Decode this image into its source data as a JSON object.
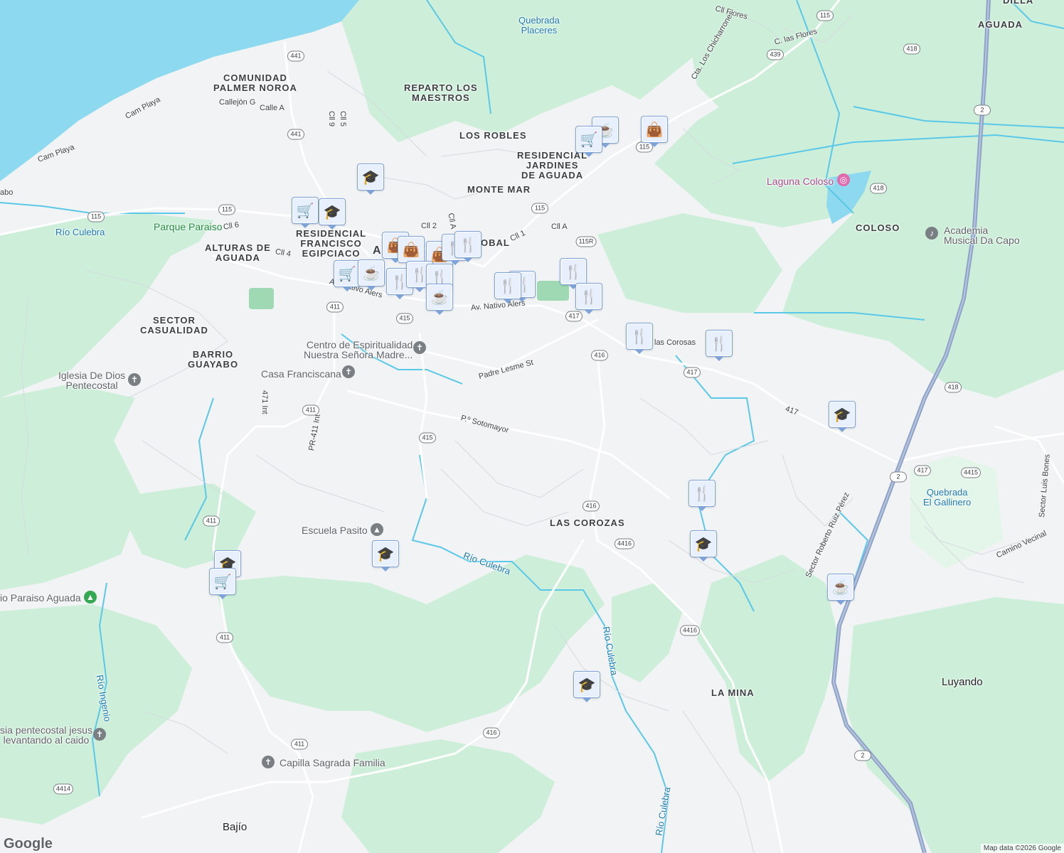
{
  "map": {
    "attribution": "Map data ©2026 Google",
    "logo": "Google",
    "colors": {
      "background": "#f1f3f4",
      "water": "#8dd9ef",
      "park": "#cdefd9",
      "road": "#ffffff",
      "highway": "#8fa3c8",
      "river": "#5ac8e8",
      "marker_fill": "#e8f0fe",
      "marker_icon": "#0b3c6f"
    }
  },
  "labels": {
    "comunidad_palmer": "COMUNIDAD\nPALMER NOROA",
    "reparto_maestros": "REPARTO LOS\nMAESTROS",
    "los_robles": "LOS ROBLES",
    "residencial_jardines": "RESIDENCIAL\nJARDINES\nDE AGUADA",
    "monte_mar": "MONTE MAR",
    "residencial_francisco": "RESIDENCIAL\nFRANCISCO\nEGIPCIACO",
    "alturas_aguada": "ALTURAS DE\nAGUADA",
    "sector_casualidad": "SECTOR\nCASUALIDAD",
    "barrio_guayabo": "BARRIO\nGUAYABO",
    "coloso": "COLOSO",
    "las_corozas": "LAS COROZAS",
    "la_mina": "LA MINA",
    "aguada_top": "AGUADA",
    "dilla": "DILLA",
    "obal": "OBAL",
    "ag": "AG",
    "luyando": "Luyando",
    "bajio": "Bajío"
  },
  "streets": {
    "cll_flores": "Cll Flores",
    "c_las_flores": "C. las Flores",
    "cta_chicharrones": "Cta. Los Chicharrones",
    "callejon_g": "Callejón G",
    "calle_a": "Calle A",
    "cam_playa_1": "Cam Playa",
    "cam_playa_2": "Cam Playa",
    "cll_6": "Cll 6",
    "cll_4": "Cll 4",
    "cll_9": "Cll 9",
    "cll_5": "Cll 5",
    "cll_2": "Cll 2",
    "cll_a_small": "Cll A",
    "cll_1": "Cll 1",
    "cll_a": "Cll A",
    "av_nativo_1": "Av. Nativo Alers",
    "av_nativo_2": "Av. Nativo Alers",
    "las_corosas": "las Corosas",
    "padre_lesme": "Padre Lesme St",
    "p_sotomayor": "P.º Sotomayor",
    "r471_int": "471 Int",
    "pr411_int": "PR-411 Int",
    "r417_text": "417",
    "sector_roberto": "Sector Roberto Ruiz Pérez",
    "sector_luis": "Sector Luis Bones",
    "camino_vecinal": "Camino Vecinal",
    "abo": "abo"
  },
  "water": {
    "quebrada_placeres": "Quebrada\nPlaceres",
    "rio_culebra_w": "Río Culebra",
    "rio_culebra_mid": "Río Culebra",
    "rio_culebra_s": "Río Culebra",
    "rio_culebra_bottom": "Río Culebra",
    "rio_ingenio": "Río Ingenio",
    "quebrada_gallinero": "Quebrada\nEl Gallinero"
  },
  "pois": {
    "laguna_coloso": "Laguna Coloso",
    "academia_musical": "Academia\nMusical Da Capo",
    "parque_paraiso": "Parque Paraiso",
    "centro_espiritualidad": "Centro de Espiritualidad\nNuestra Señora Madre...",
    "casa_franciscana": "Casa Franciscana",
    "iglesia_dios": "Iglesia De Dios\nPentecostal",
    "escuela_pasito": "Escuela Pasito",
    "paraiso_aguada": "io Paraiso Aguada",
    "iglesia_jesus": "sia pentecostal jesus\nlevantando al caido",
    "capilla_sagrada": "Capilla Sagrada Familia"
  },
  "route_shields": [
    "115",
    "441",
    "441",
    "115",
    "115",
    "115R",
    "439",
    "418",
    "418",
    "418",
    "2",
    "2",
    "2",
    "411",
    "415",
    "411",
    "411",
    "411",
    "411",
    "415",
    "417",
    "416",
    "416",
    "4416",
    "4416",
    "417",
    "4415",
    "416",
    "411",
    "4414"
  ],
  "markers": [
    "coffee",
    "shopping-cart",
    "shopping-bag",
    "graduation-cap",
    "shopping-cart",
    "graduation-cap",
    "shopping-bag",
    "shopping-bag",
    "shopping-bag",
    "restaurant",
    "restaurant",
    "shopping-cart",
    "coffee",
    "restaurant",
    "restaurant",
    "restaurant",
    "coffee",
    "restaurant",
    "restaurant",
    "restaurant",
    "restaurant",
    "restaurant",
    "restaurant",
    "graduation-cap",
    "restaurant",
    "graduation-cap",
    "graduation-cap",
    "graduation-cap",
    "shopping-cart",
    "coffee",
    "graduation-cap"
  ]
}
